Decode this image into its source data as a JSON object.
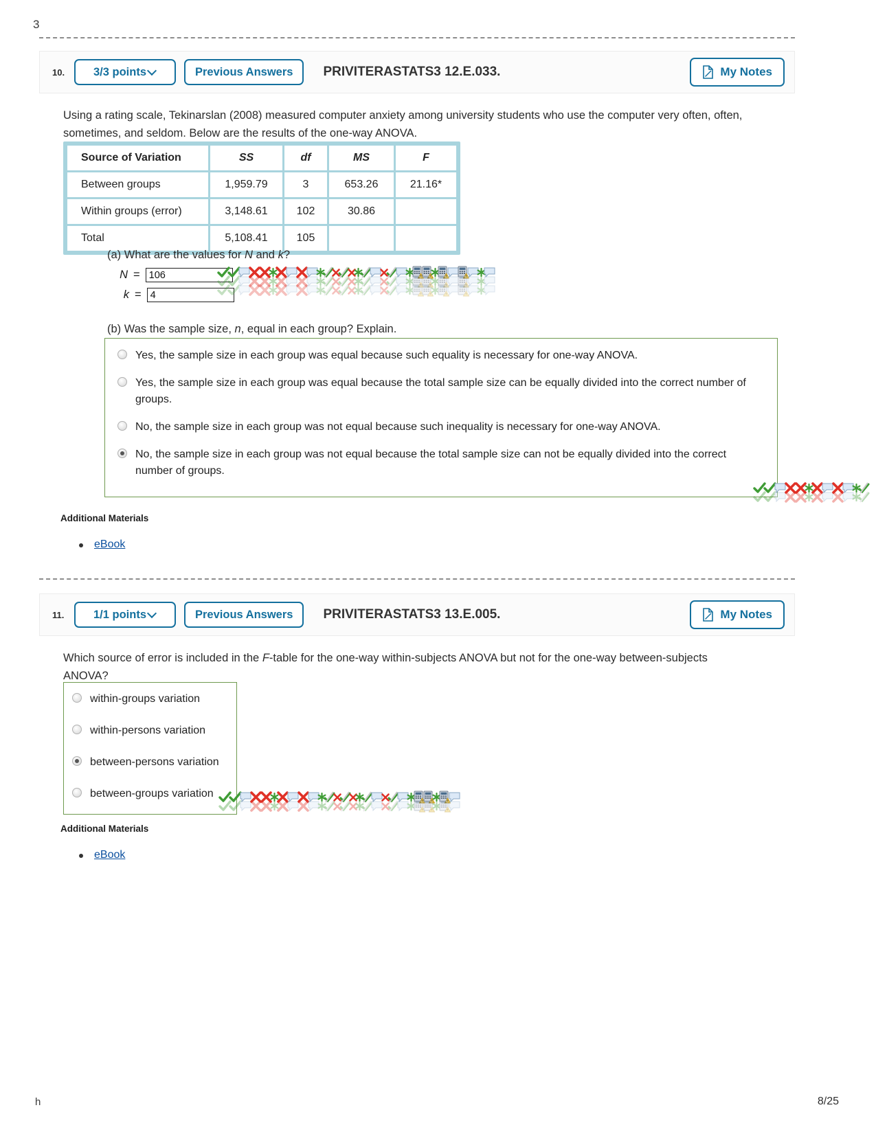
{
  "document": {
    "top_stub": "3",
    "footer_left": "h",
    "page_number": "8/25"
  },
  "questions": [
    {
      "number": "10.",
      "points_label": "3/3 points",
      "previous_answers_label": "Previous Answers",
      "code": "PRIVITERASTATS3 12.E.033.",
      "my_notes_label": "My Notes",
      "prompt": "Using a rating scale, Tekinarslan (2008) measured computer anxiety among university students who use the computer very often, often, sometimes, and seldom. Below are the results of the one-way ANOVA.",
      "table": {
        "headers": [
          "Source of Variation",
          "SS",
          "df",
          "MS",
          "F"
        ],
        "rows": [
          [
            "Between groups",
            "1,959.79",
            "3",
            "653.26",
            "21.16*"
          ],
          [
            "Within groups (error)",
            "3,148.61",
            "102",
            "30.86",
            ""
          ],
          [
            "Total",
            "5,108.41",
            "105",
            "",
            ""
          ]
        ]
      },
      "part_a": {
        "label": "(a) What are the values for",
        "var1": "N",
        "conj": "and",
        "var2": "k",
        "suffix": "?",
        "n_label": "N",
        "n_value": "106",
        "k_label": "k",
        "k_value": "4",
        "equals": "="
      },
      "part_b": {
        "label_pre": "(b) Was the sample size,",
        "label_var": "n",
        "label_post": ", equal in each group? Explain.",
        "choices": [
          {
            "text": "Yes, the sample size in each group was equal because such equality is necessary for one-way ANOVA.",
            "selected": false
          },
          {
            "text": "Yes, the sample size in each group was equal because the total sample size can be equally divided into the correct number of groups.",
            "selected": false
          },
          {
            "text": "No, the sample size in each group was not equal because such inequality is necessary for one-way ANOVA.",
            "selected": false
          },
          {
            "text": "No, the sample size in each group was not equal because the total sample size can not be equally divided into the correct number of groups.",
            "selected": true
          }
        ]
      },
      "additional_materials_label": "Additional Materials",
      "ebook_label": "eBook"
    },
    {
      "number": "11.",
      "points_label": "1/1 points",
      "previous_answers_label": "Previous Answers",
      "code": "PRIVITERASTATS3 13.E.005.",
      "my_notes_label": "My Notes",
      "prompt_pre": "Which source of error is included in the",
      "prompt_var": "F",
      "prompt_post": "-table for the one-way within-subjects ANOVA but not for the one-way between-subjects ANOVA?",
      "choices": [
        {
          "text": "within-groups variation",
          "selected": false
        },
        {
          "text": "within-persons variation",
          "selected": false
        },
        {
          "text": "between-persons variation",
          "selected": true
        },
        {
          "text": "between-groups variation",
          "selected": false
        }
      ],
      "additional_materials_label": "Additional Materials",
      "ebook_label": "eBook"
    }
  ],
  "colors": {
    "accent_blue": "#14709e",
    "link_blue": "#0b4f9e",
    "table_grid": "#a8d4de",
    "choice_border": "#6f9a4f",
    "correct_green": "#3f9c35",
    "incorrect_red": "#e03127"
  },
  "icons": {
    "note": "note-page-icon",
    "chevron": "chevron-down-icon",
    "feedback_correct": "green-check-icon",
    "feedback_incorrect": "red-x-icon",
    "feedback_star": "green-asterisk-icon",
    "feedback_comment": "speech-bubble-icon",
    "feedback_calculator": "calculator-warning-icon"
  }
}
